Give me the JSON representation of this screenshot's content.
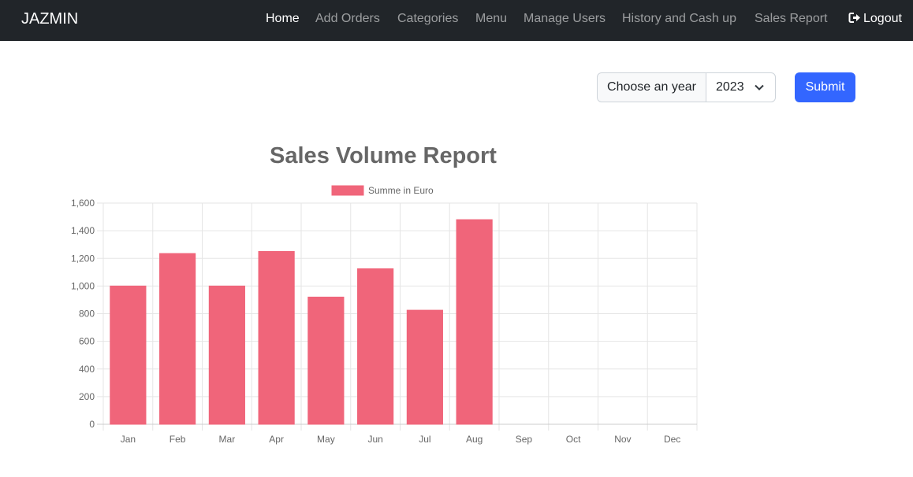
{
  "navbar": {
    "brand": "JAZMIN",
    "links": [
      "Home",
      "Add Orders",
      "Categories",
      "Menu",
      "Manage Users",
      "History and Cash up",
      "Sales Report"
    ],
    "active": "Home",
    "logout_label": "Logout"
  },
  "filter": {
    "label": "Choose an year",
    "selected_year": "2023",
    "submit_label": "Submit"
  },
  "colors": {
    "navbar_bg": "#212529",
    "bar_fill": "#f0657a",
    "submit_bg": "#3366ff"
  },
  "chart_data": {
    "type": "bar",
    "title": "Sales Volume Report",
    "categories": [
      "Jan",
      "Feb",
      "Mar",
      "Apr",
      "May",
      "Jun",
      "Jul",
      "Aug",
      "Sep",
      "Oct",
      "Nov",
      "Dec"
    ],
    "series": [
      {
        "name": "Summe in Euro",
        "values": [
          1000,
          1235,
          1000,
          1250,
          920,
          1125,
          825,
          1480,
          0,
          0,
          0,
          0
        ]
      }
    ],
    "ylim": [
      0,
      1600
    ],
    "yticks": [
      "0",
      "200",
      "400",
      "600",
      "800",
      "1,000",
      "1,200",
      "1,400",
      "1,600"
    ],
    "legend": "top-center",
    "grid": true
  }
}
